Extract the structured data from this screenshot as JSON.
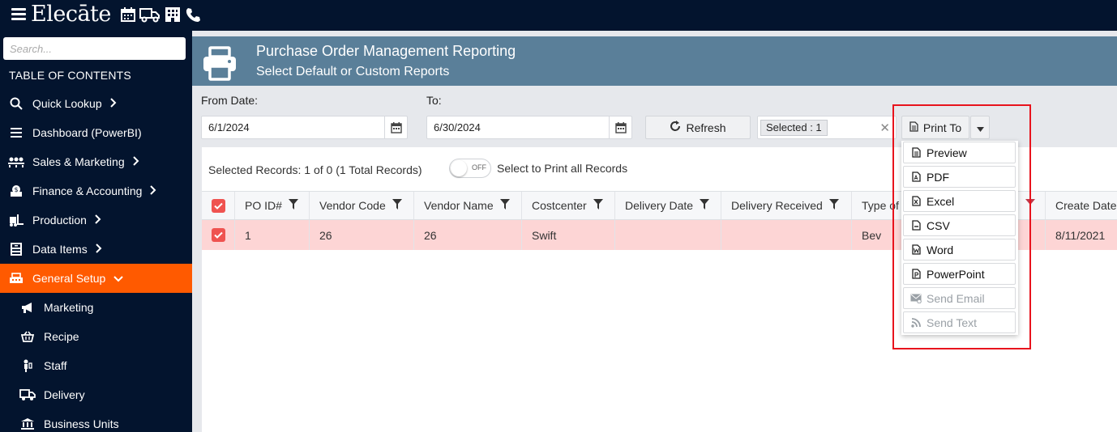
{
  "app": {
    "logo": "Elecāte"
  },
  "topbar_icons": [
    "calendar-icon",
    "truck-icon",
    "building-icon",
    "phone-icon"
  ],
  "sidebar": {
    "search_placeholder": "Search...",
    "toc_label": "TABLE OF CONTENTS",
    "items": [
      {
        "label": "Quick Lookup",
        "icon": "search-icon",
        "has_children": true
      },
      {
        "label": "Dashboard (PowerBI)",
        "icon": "list-icon",
        "has_children": false
      },
      {
        "label": "Sales & Marketing",
        "icon": "people-icon",
        "has_children": true
      },
      {
        "label": "Finance & Accounting",
        "icon": "money-icon",
        "has_children": true
      },
      {
        "label": "Production",
        "icon": "forklift-icon",
        "has_children": true
      },
      {
        "label": "Data Items",
        "icon": "database-icon",
        "has_children": true
      },
      {
        "label": "General Setup",
        "icon": "cash-register-icon",
        "has_children": true,
        "active": true
      }
    ],
    "subitems": [
      {
        "label": "Marketing",
        "icon": "bullhorn-icon"
      },
      {
        "label": "Recipe",
        "icon": "basket-icon"
      },
      {
        "label": "Staff",
        "icon": "staff-icon"
      },
      {
        "label": "Delivery",
        "icon": "truck-icon"
      },
      {
        "label": "Business Units",
        "icon": "bank-icon"
      }
    ],
    "accent_color": "#ff5a00"
  },
  "header": {
    "title": "Purchase Order Management Reporting",
    "subtitle": "Select Default or Custom Reports"
  },
  "filters": {
    "from_label": "From Date:",
    "from_value": "6/1/2024",
    "to_label": "To:",
    "to_value": "6/30/2024",
    "refresh_label": "Refresh",
    "selected_chip": "Selected : 1",
    "print_to_label": "Print To"
  },
  "records": {
    "info": "Selected Records: 1 of 0 (1 Total Records)",
    "toggle_state": "OFF",
    "toggle_label": "Select to Print all Records"
  },
  "grid": {
    "columns": [
      "PO ID#",
      "Vendor Code",
      "Vendor Name",
      "Costcenter",
      "Delivery Date",
      "Delivery Received",
      "Type of",
      "Create Date"
    ],
    "rows": [
      {
        "po_id": "1",
        "vendor_code": "26",
        "vendor_name": "26",
        "costcenter": "Swift",
        "delivery_date": "",
        "delivery_received": "",
        "type": "Bev",
        "create_date": "8/11/2021"
      }
    ],
    "row_selected_color": "#fdd5d5"
  },
  "print_menu": {
    "items": [
      {
        "label": "Preview",
        "icon": "preview-doc-icon",
        "enabled": true
      },
      {
        "label": "PDF",
        "icon": "pdf-file-icon",
        "enabled": true
      },
      {
        "label": "Excel",
        "icon": "excel-file-icon",
        "enabled": true
      },
      {
        "label": "CSV",
        "icon": "csv-file-icon",
        "enabled": true
      },
      {
        "label": "Word",
        "icon": "word-file-icon",
        "enabled": true
      },
      {
        "label": "PowerPoint",
        "icon": "powerpoint-file-icon",
        "enabled": true
      },
      {
        "label": "Send Email",
        "icon": "email-icon",
        "enabled": false
      },
      {
        "label": "Send Text",
        "icon": "rss-icon",
        "enabled": false
      }
    ]
  }
}
